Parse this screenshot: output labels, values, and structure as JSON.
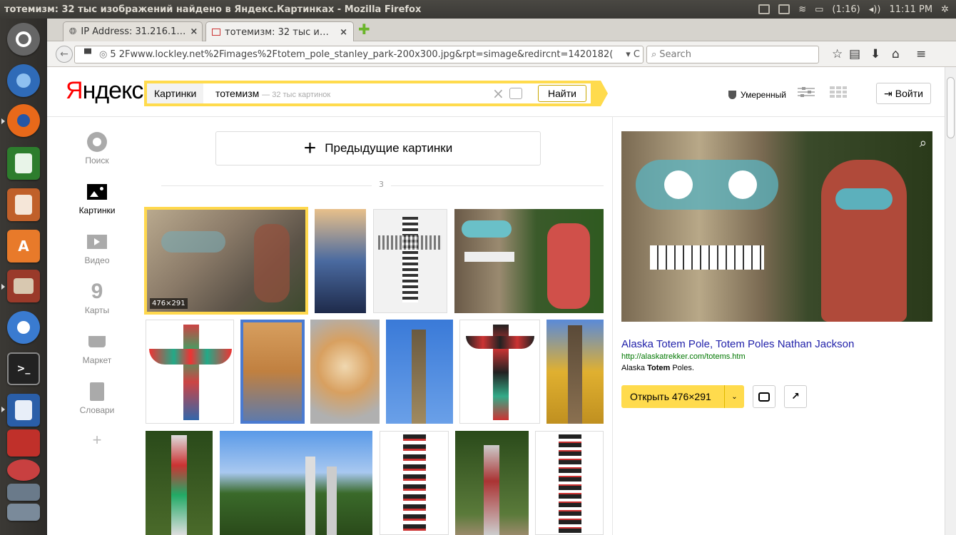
{
  "window": {
    "title": "тотемизм: 32 тыс изображений найдено в Яндекс.Картинках - Mozilla Firefox"
  },
  "tray": {
    "battery": "(1:16)",
    "clock": "11:11 PM"
  },
  "tabs": [
    {
      "label": "IP Address: 31.216.1…",
      "close": "×"
    },
    {
      "label": "тотемизм: 32 тыс и…",
      "close": "×"
    }
  ],
  "nav": {
    "url": "5 2Fwww.lockley.net%2Fimages%2Ftotem_pole_stanley_park-200x300.jpg&rpt=simage&redircnt=1420182(",
    "search_placeholder": "Search"
  },
  "yandex": {
    "logo": "Яндекс",
    "service": "Картинки",
    "query": "тотемизм",
    "count": "— 32 тыс картинок",
    "find_label": "Найти",
    "filter_label": "Умеренный",
    "login_label": "Войти"
  },
  "leftnav": [
    {
      "label": "Поиск",
      "icon": "search-circle-icon"
    },
    {
      "label": "Картинки",
      "icon": "image-icon"
    },
    {
      "label": "Видео",
      "icon": "play-icon"
    },
    {
      "label": "Карты",
      "icon": "map-pin-icon"
    },
    {
      "label": "Маркет",
      "icon": "cart-icon"
    },
    {
      "label": "Словари",
      "icon": "book-icon"
    }
  ],
  "results": {
    "prev_label": "Предыдущие картинки",
    "page_number": "3",
    "selected_dim": "476×291"
  },
  "preview": {
    "title": "Alaska Totem Pole, Totem Poles Nathan Jackson",
    "url": "http://alaskatrekker.com/totems.htm",
    "desc_pre": "Alaska ",
    "desc_bold": "Totem",
    "desc_post": " Poles.",
    "open_label": "Открыть 476×291"
  },
  "colors": {
    "brand_yellow": "#ffdb4d",
    "link_blue": "#2222aa",
    "url_green": "#007700",
    "ubuntu_bar": "#3a3935"
  }
}
